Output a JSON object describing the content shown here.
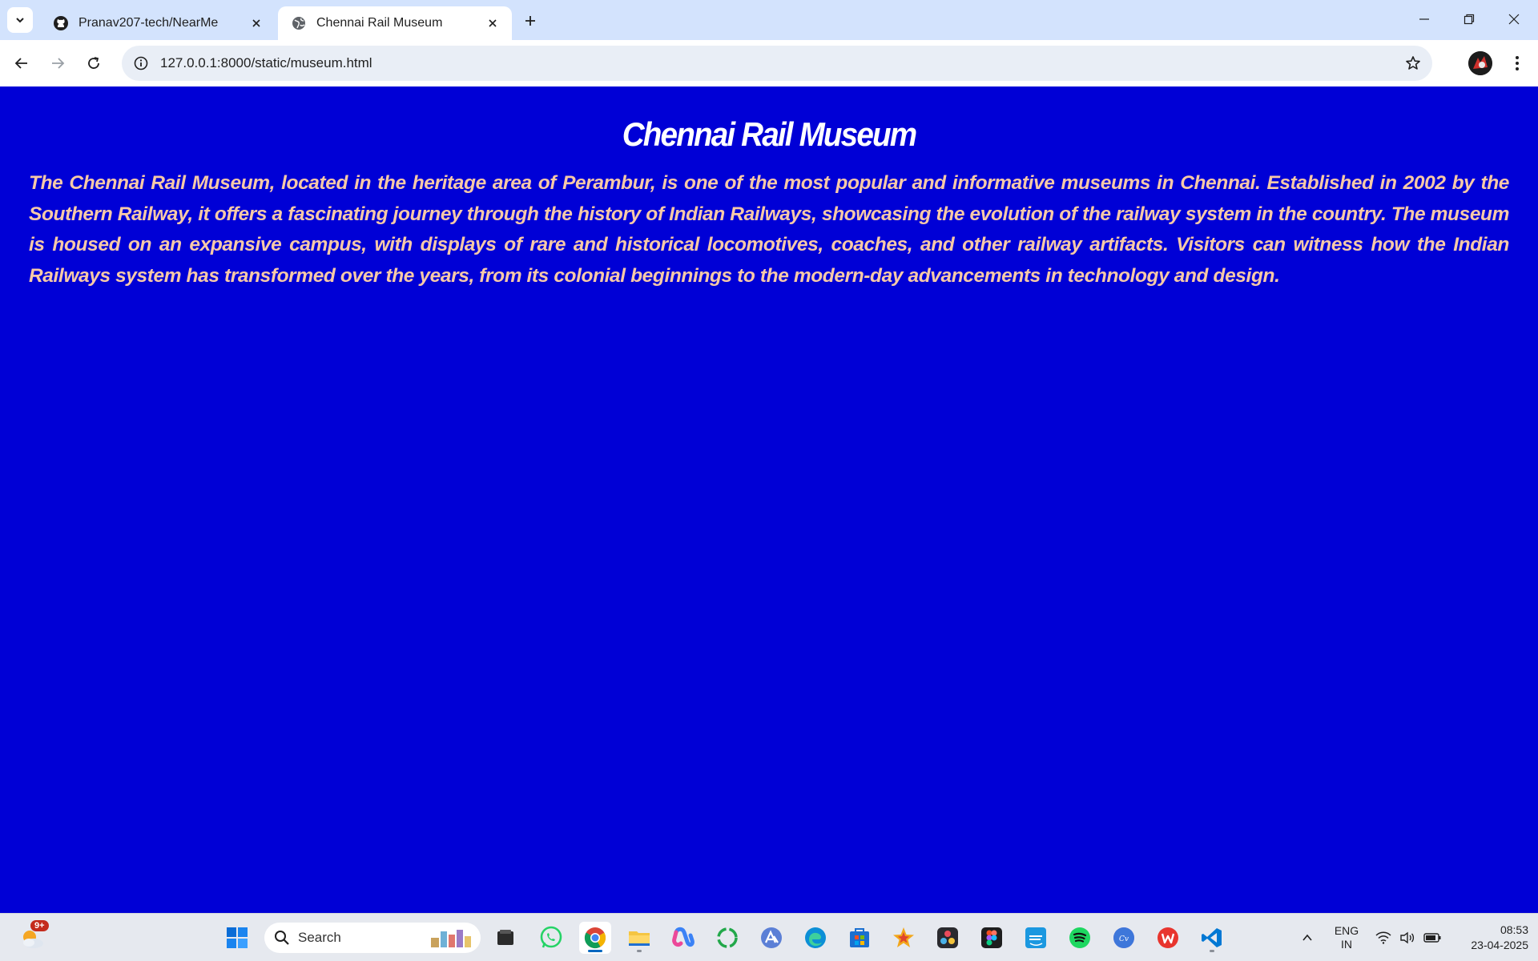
{
  "browser": {
    "tabs": [
      {
        "title": "Pranav207-tech/NearMe",
        "favicon": "github-icon",
        "active": false
      },
      {
        "title": "Chennai Rail Museum",
        "favicon": "globe-icon",
        "active": true
      }
    ],
    "url": "127.0.0.1:8000/static/museum.html"
  },
  "page": {
    "title": "Chennai Rail Museum",
    "description": "The Chennai Rail Museum, located in the heritage area of Perambur, is one of the most popular and informative museums in Chennai. Established in 2002 by the Southern Railway, it offers a fascinating journey through the history of Indian Railways, showcasing the evolution of the railway system in the country. The museum is housed on an expansive campus, with displays of rare and historical locomotives, coaches, and other railway artifacts. Visitors can witness how the Indian Railways system has transformed over the years, from its colonial beginnings to the modern-day advancements in technology and design."
  },
  "taskbar": {
    "weather_badge": "9+",
    "search_label": "Search",
    "language": {
      "line1": "ENG",
      "line2": "IN"
    },
    "time": "08:53",
    "date": "23-04-2025",
    "apps": [
      "start-icon",
      "file-manager-icon",
      "whatsapp-icon",
      "chrome-icon",
      "file-explorer-icon",
      "copilot-icon",
      "refresh-app-icon",
      "arc-icon",
      "edge-icon",
      "microsoft-store-icon",
      "star-app-icon",
      "davinci-icon",
      "figma-icon",
      "prime-video-icon",
      "spotify-icon",
      "canva-icon",
      "wps-icon",
      "vscode-icon"
    ]
  },
  "colors": {
    "page_background": "#0000d6",
    "heading": "#ffffff",
    "body_text": "#f7c9a8"
  }
}
